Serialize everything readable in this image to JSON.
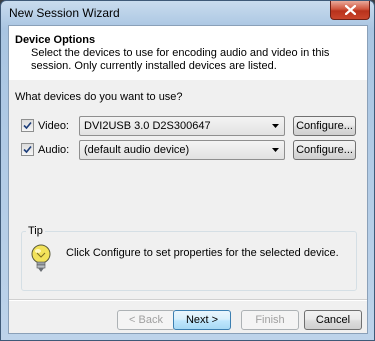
{
  "window": {
    "title": "New Session Wizard"
  },
  "header": {
    "title": "Device Options",
    "description": "Select the devices to use for encoding audio and video in this session. Only currently installed devices are listed."
  },
  "devices": {
    "question": "What devices do you want to use?",
    "video": {
      "label": "Video:",
      "checked": true,
      "selected": "DVI2USB 3.0 D2S300647",
      "configure_label": "Configure..."
    },
    "audio": {
      "label": "Audio:",
      "checked": true,
      "selected": "(default audio device)",
      "configure_label": "Configure..."
    }
  },
  "tip": {
    "title": "Tip",
    "text": "Click Configure to set properties for the selected device."
  },
  "footer": {
    "back_label": "< Back",
    "next_label": "Next >",
    "finish_label": "Finish",
    "cancel_label": "Cancel"
  },
  "icons": {
    "close": "close-icon",
    "checkmark": "checkmark-icon",
    "dropdown": "chevron-down-icon",
    "tip": "lightbulb-icon"
  },
  "colors": {
    "titlebar": "#a9c5e2",
    "close_button": "#c9452c",
    "default_button": "#3c7fb1",
    "tip_icon": "#e8d84a"
  }
}
